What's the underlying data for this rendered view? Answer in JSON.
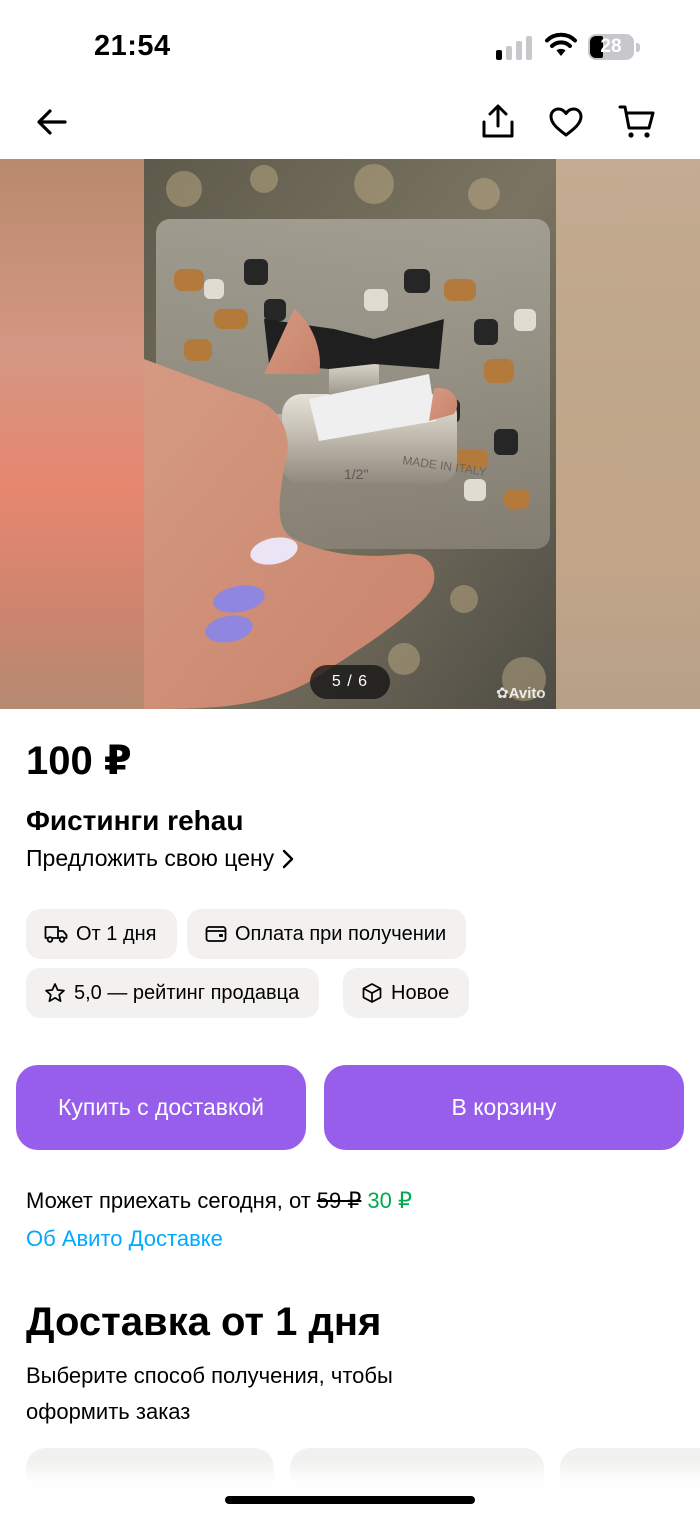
{
  "status": {
    "time": "21:54",
    "battery_level": "28",
    "signal_bars": 1
  },
  "nav": {
    "back_icon": "arrow-left-icon",
    "share_icon": "share-icon",
    "favorite_icon": "heart-icon",
    "cart_icon": "cart-icon"
  },
  "gallery": {
    "counter": "5 / 6",
    "watermark": "Avito",
    "item_stamp_1": "MADE IN ITALY",
    "item_stamp_2": "1/2\""
  },
  "listing": {
    "price": "100 ₽",
    "title": "Фистинги rehau",
    "offer_link": "Предложить свою цену"
  },
  "chips": [
    {
      "icon": "truck-icon",
      "label": "От 1 дня"
    },
    {
      "icon": "wallet-icon",
      "label": "Оплата при получении"
    },
    {
      "icon": "star-icon",
      "label": "5,0 — рейтинг продавца"
    },
    {
      "icon": "box-icon",
      "label": "Новое"
    }
  ],
  "actions": {
    "buy_label": "Купить с доставкой",
    "cart_label": "В корзину"
  },
  "delivery": {
    "line_prefix": "Может приехать сегодня, от",
    "old_price": "59 ₽",
    "new_price": "30 ₽",
    "about_link": "Об Авито Доставке",
    "heading": "Доставка от 1 дня",
    "subtext": "Выберите способ получения, чтобы оформить заказ"
  },
  "colors": {
    "accent": "#965eeb",
    "link": "#00aaff",
    "discount": "#02a94f",
    "chip_bg": "#f2f1f0"
  }
}
